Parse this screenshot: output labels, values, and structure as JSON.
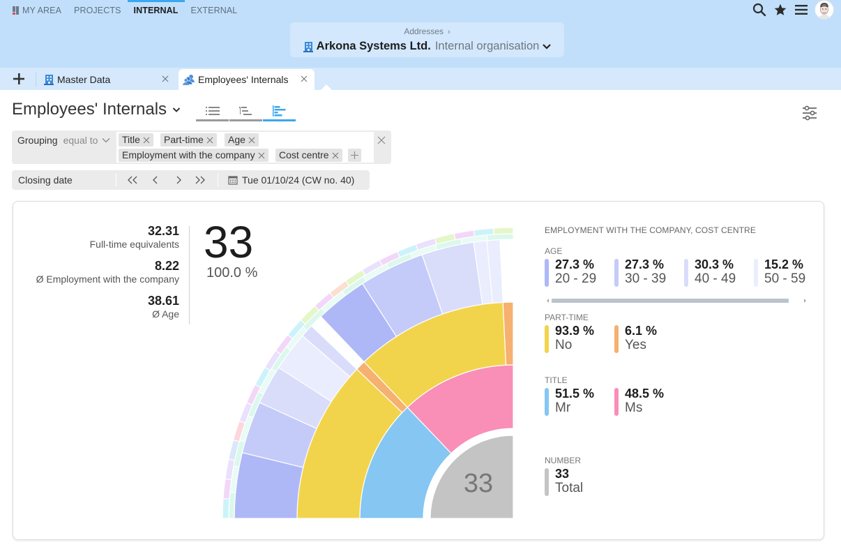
{
  "nav": {
    "items": [
      {
        "label": "MY AREA",
        "active": false
      },
      {
        "label": "PROJECTS",
        "active": false
      },
      {
        "label": "INTERNAL",
        "active": true
      },
      {
        "label": "EXTERNAL",
        "active": false
      }
    ],
    "icons": [
      "search-icon",
      "star-icon",
      "menu-icon",
      "avatar"
    ]
  },
  "breadcrumb": {
    "parent": "Addresses",
    "separator": "›",
    "name": "Arkona Systems Ltd.",
    "subtitle": "Internal organisation"
  },
  "tabs": [
    {
      "label": "Master Data",
      "icon": "building-icon",
      "active": false
    },
    {
      "label": "Employees' Internals",
      "icon": "people-icon",
      "active": true
    }
  ],
  "page": {
    "title": "Employees' Internals",
    "views": [
      {
        "name": "list-view",
        "active": false
      },
      {
        "name": "tree-view",
        "active": false
      },
      {
        "name": "chart-view",
        "active": true
      }
    ]
  },
  "grouping": {
    "label": "Grouping",
    "operator": "equal to",
    "chips": [
      "Title",
      "Part-time",
      "Age",
      "Employment with the company",
      "Cost centre"
    ]
  },
  "closing_date": {
    "label": "Closing date",
    "value": "Tue 01/10/24 (CW no. 40)"
  },
  "kpis": [
    {
      "value": "32.31",
      "label": "Full-time equivalents"
    },
    {
      "value": "8.22",
      "label": "Ø Employment with the company"
    },
    {
      "value": "38.61",
      "label": "Ø Age"
    }
  ],
  "total": {
    "count": "33",
    "percent": "100.0 %"
  },
  "legend": {
    "title": "EMPLOYMENT WITH THE COMPANY, COST CENTRE",
    "groups": [
      {
        "title": "AGE",
        "items": [
          {
            "pct": "27.3 %",
            "name": "20 - 29",
            "color": "#aeb8f7"
          },
          {
            "pct": "27.3 %",
            "name": "30 - 39",
            "color": "#c4cbf9"
          },
          {
            "pct": "30.3 %",
            "name": "40 - 49",
            "color": "#d9ddfa"
          },
          {
            "pct": "15.2 %",
            "name": "50 - 59",
            "color": "#eaedfd"
          }
        ]
      },
      {
        "title": "PART-TIME",
        "items": [
          {
            "pct": "93.9 %",
            "name": "No",
            "color": "#f2d44c"
          },
          {
            "pct": "6.1 %",
            "name": "Yes",
            "color": "#f6b06f"
          }
        ]
      },
      {
        "title": "TITLE",
        "items": [
          {
            "pct": "51.5 %",
            "name": "Mr",
            "color": "#85c6f2"
          },
          {
            "pct": "48.5 %",
            "name": "Ms",
            "color": "#f98eb6"
          }
        ]
      },
      {
        "title": "NUMBER",
        "items": [
          {
            "pct": "33",
            "name": "Total",
            "color": "#c4c4c4"
          }
        ]
      }
    ]
  },
  "chart_data": {
    "type": "sunburst",
    "total": 33,
    "center_label": "33",
    "rings": [
      "Title",
      "Part-time",
      "Age",
      "Employment with the company",
      "Cost centre"
    ],
    "hierarchy": [
      {
        "name": "Mr",
        "value": 17,
        "color": "#85c6f2",
        "children": [
          {
            "name": "No",
            "value": 16,
            "color": "#f2d44c",
            "children": [
              {
                "name": "20 - 29",
                "value": 5,
                "color": "#aeb8f7"
              },
              {
                "name": "30 - 39",
                "value": 4,
                "color": "#c4cbf9"
              },
              {
                "name": "40 - 49",
                "value": 3,
                "color": "#d9ddfa"
              },
              {
                "name": "50 - 59",
                "value": 3,
                "color": "#eaedfd"
              },
              {
                "name": "40 - 49",
                "value": 1,
                "color": "#d9ddfa"
              }
            ]
          },
          {
            "name": "Yes",
            "value": 1,
            "color": "#f6b06f",
            "children": []
          }
        ]
      },
      {
        "name": "Ms",
        "value": 16,
        "color": "#f98eb6",
        "children": [
          {
            "name": "No",
            "value": 15,
            "color": "#f2d44c",
            "children": [
              {
                "name": "20 - 29",
                "value": 4,
                "color": "#aeb8f7"
              },
              {
                "name": "30 - 39",
                "value": 5,
                "color": "#c4cbf9"
              },
              {
                "name": "40 - 49",
                "value": 4,
                "color": "#d9ddfa"
              },
              {
                "name": "50 - 59",
                "value": 1,
                "color": "#eaedfd"
              },
              {
                "name": "50 - 59",
                "value": 1,
                "color": "#eaedfd"
              }
            ]
          },
          {
            "name": "Yes",
            "value": 1,
            "color": "#f6b06f",
            "children": []
          }
        ]
      }
    ],
    "outer_ring_colors": [
      "#cdf3fa",
      "#f3d7f9",
      "#e9e1fd",
      "#d9e8fa",
      "#fcd8dc",
      "#e9e1fd",
      "#f3d7f9",
      "#cdf3fa",
      "#e9e1fd",
      "#f3d7f9",
      "#cdf3fa",
      "#e5f6c9",
      "#f3d7f9",
      "#fbdfd0",
      "#e5f6c9",
      "#e9e1fd",
      "#f3d7f9",
      "#cdf3fa",
      "#e9e1fd",
      "#e5f6c9",
      "#f3d7f9",
      "#cdf3fa",
      "#e5f6c9"
    ],
    "employment_ring_color": "#dbf8ec"
  }
}
